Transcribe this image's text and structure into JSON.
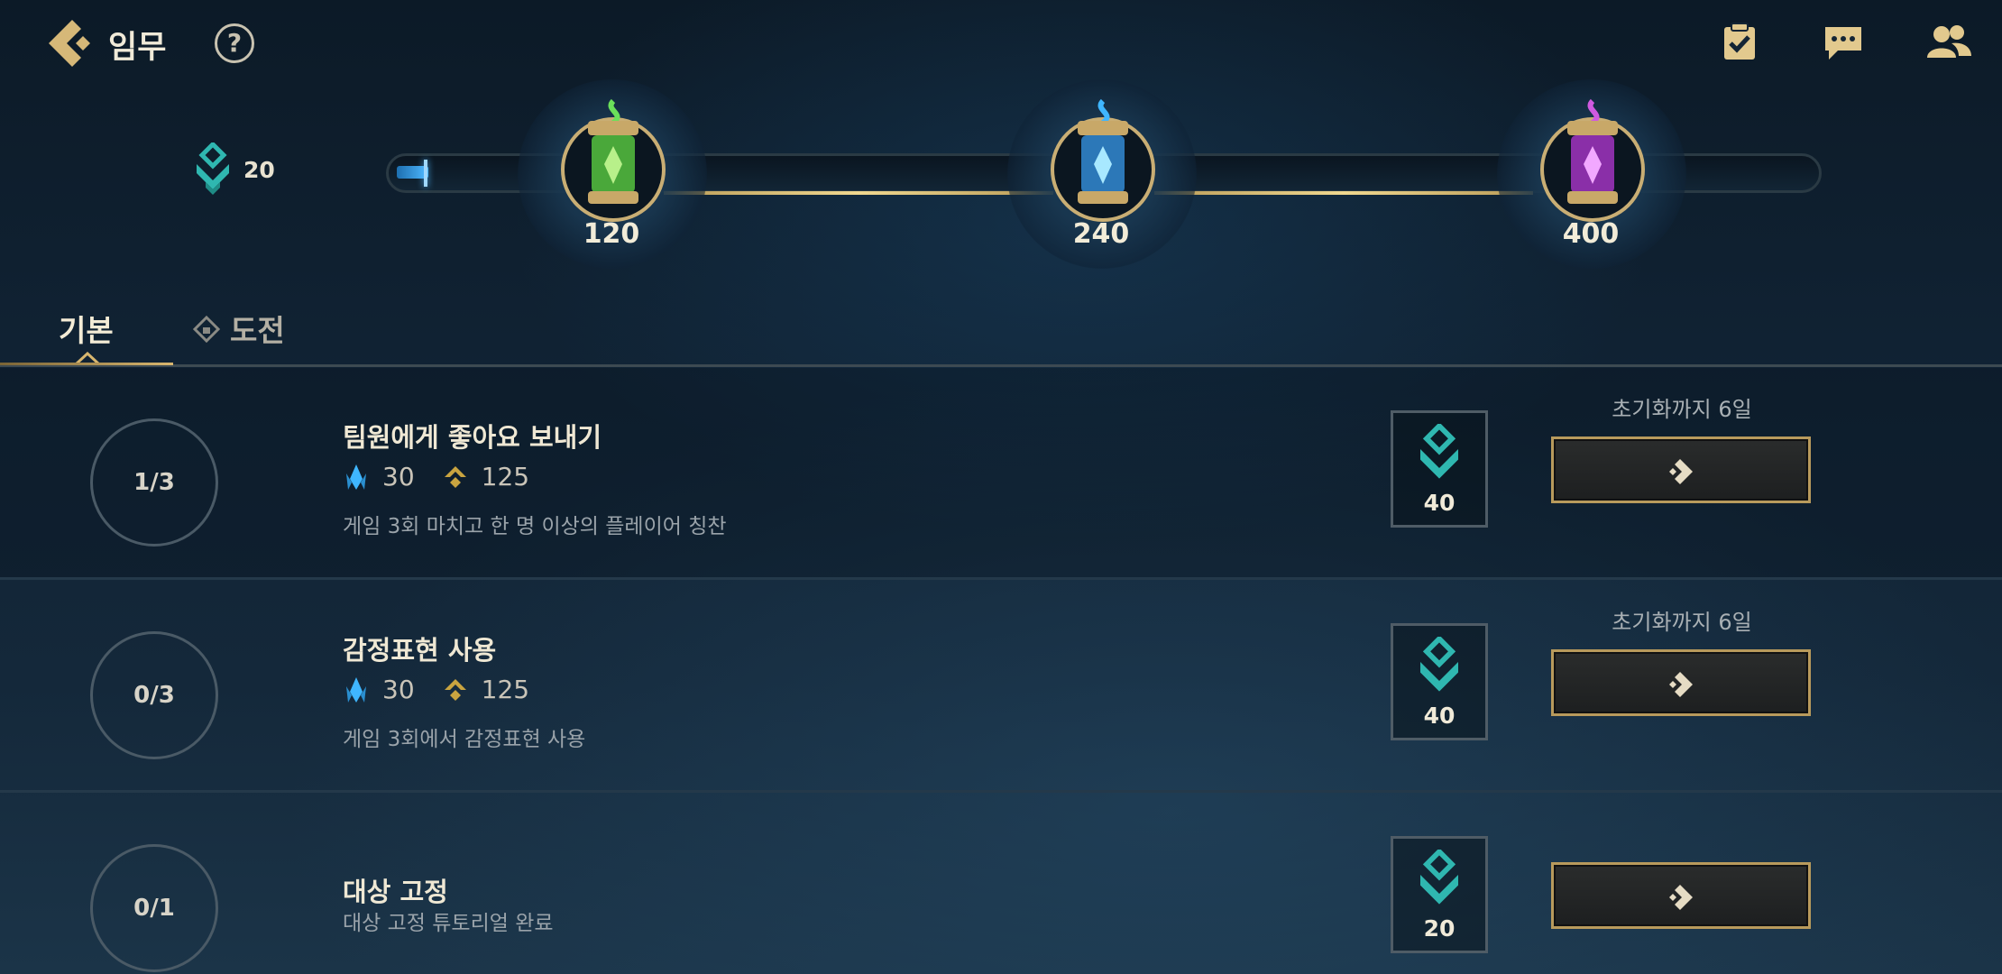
{
  "header": {
    "title": "임무",
    "help_label": "?"
  },
  "progress": {
    "current_points": "20",
    "current_fraction": 0.05,
    "milestones": [
      {
        "label": "120",
        "capsule": "green"
      },
      {
        "label": "240",
        "capsule": "blue"
      },
      {
        "label": "400",
        "capsule": "purple"
      }
    ]
  },
  "tabs": [
    {
      "label": "기본",
      "active": true
    },
    {
      "label": "도전",
      "active": false,
      "icon": "lock-icon"
    }
  ],
  "missions": [
    {
      "progress": "1/3",
      "title": "팀원에게 좋아요 보내기",
      "blue_essence": "30",
      "gold": "125",
      "description": "게임 3회 마치고 한 명 이상의 플레이어 칭찬",
      "token_reward": "40",
      "reset": "초기화까지 6일"
    },
    {
      "progress": "0/3",
      "title": "감정표현 사용",
      "blue_essence": "30",
      "gold": "125",
      "description": "게임 3회에서 감정표현 사용",
      "token_reward": "40",
      "reset": "초기화까지 6일"
    },
    {
      "progress": "0/1",
      "title": "대상 고정",
      "description": "대상 고정 튜토리얼 완료",
      "token_reward": "20"
    }
  ],
  "colors": {
    "gold": "#c9ae74",
    "teal": "#2fb7b0",
    "blue_essence": "#3fb6ff"
  }
}
